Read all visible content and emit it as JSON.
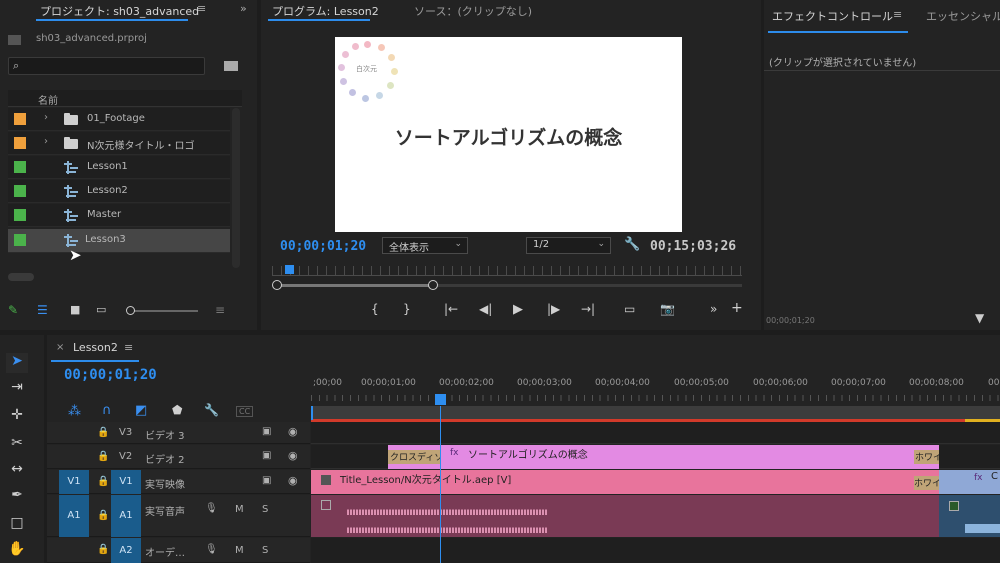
{
  "project_panel": {
    "tab_label": "プロジェクト: sh03_advanced",
    "file_name": "sh03_advanced.prproj",
    "column_name": "名前",
    "items": [
      {
        "label": "01_Footage",
        "type": "folder",
        "color": "#f0a03c"
      },
      {
        "label": "N次元様タイトル・ロゴ",
        "type": "folder",
        "color": "#f0a03c"
      },
      {
        "label": "Lesson1",
        "type": "sequence",
        "color": "#4bb34b"
      },
      {
        "label": "Lesson2",
        "type": "sequence",
        "color": "#4bb34b"
      },
      {
        "label": "Master",
        "type": "sequence",
        "color": "#4bb34b"
      },
      {
        "label": "Lesson3",
        "type": "sequence",
        "color": "#4bb34b"
      }
    ]
  },
  "program_monitor": {
    "tab_program": "プログラム: Lesson2",
    "tab_source": "ソース：(クリップなし)",
    "video_title": "ソートアルゴリズムの概念",
    "logo_text": "白次元",
    "current_time": "00;00;01;20",
    "fit_label": "全体表示",
    "resolution": "1/2",
    "duration": "00;15;03;26"
  },
  "effect_panel": {
    "tab_effect": "エフェクトコントロール",
    "tab_essential": "エッセンシャル",
    "no_clip_text": "(クリップが選択されていません)",
    "footer_time": "00;00;01;20"
  },
  "timeline": {
    "tab_label": "Lesson2",
    "current_time": "00;00;01;20",
    "ruler": [
      ";00;00",
      "00;00;01;00",
      "00;00;02;00",
      "00;00;03;00",
      "00;00;04;00",
      "00;00;05;00",
      "00;00;06;00",
      "00;00;07;00",
      "00;00;08;00",
      "00"
    ],
    "tracks": [
      {
        "id": "V3",
        "name": "ビデオ 3"
      },
      {
        "id": "V2",
        "name": "ビデオ 2"
      },
      {
        "id": "V1",
        "src": "V1",
        "name": "実写映像"
      },
      {
        "id": "A1",
        "src": "A1",
        "name": "実写音声",
        "m": "M",
        "s": "S"
      },
      {
        "id": "A2",
        "name": "オーデ…",
        "m": "M",
        "s": "S"
      }
    ],
    "clips": {
      "v2_transition": "クロスディゾ",
      "v2_title": "ソートアルゴリズムの概念",
      "v2_end_transition": "ホワイ",
      "v1_clip": "Title_Lesson/N次元タイトル.aep [V]",
      "v1_end_transition": "ホワイトアウ",
      "v1_next": "C"
    },
    "cc_label": "CC"
  }
}
